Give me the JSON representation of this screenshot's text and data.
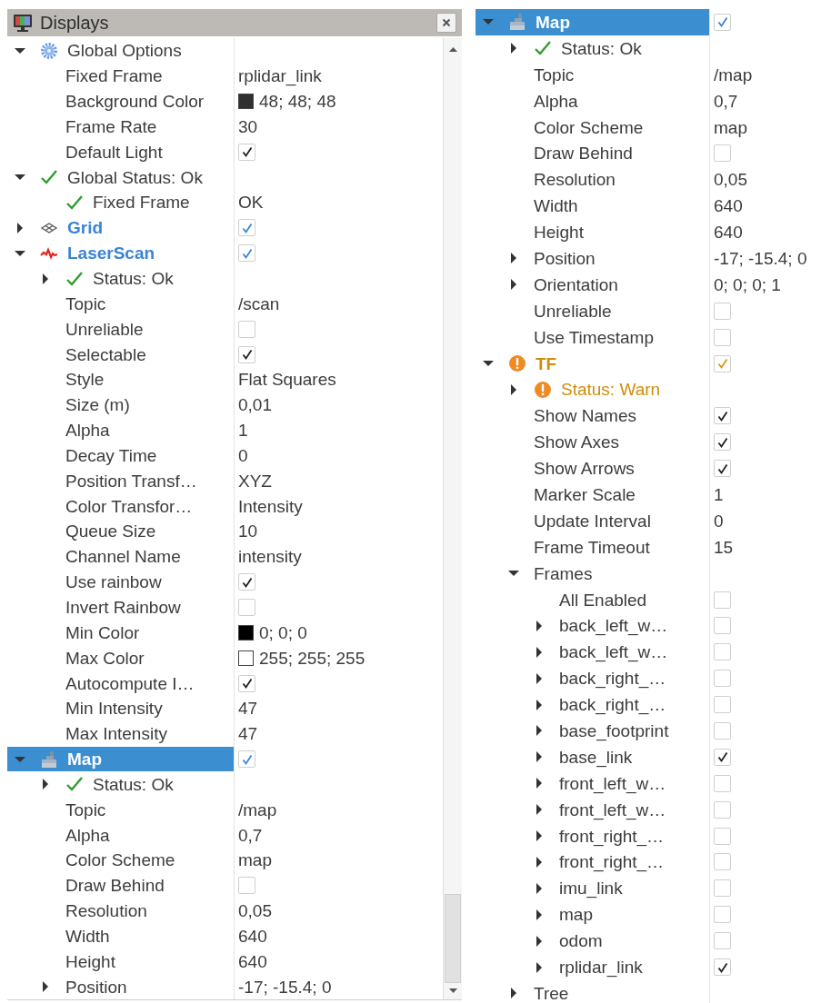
{
  "panels": [
    {
      "title": "Displays",
      "tree": [
        {
          "label": "Global Options",
          "kind": "options",
          "selected": false,
          "expanded": true,
          "children": [
            {
              "label": "Fixed Frame",
              "kind": "property",
              "value": "rplidar_link"
            },
            {
              "label": "Background Color",
              "kind": "color",
              "color": "#303030",
              "value": "48; 48; 48"
            },
            {
              "label": "Frame Rate",
              "kind": "property",
              "value": "30"
            },
            {
              "label": "Default Light",
              "kind": "property",
              "checked": true
            }
          ]
        },
        {
          "label": "Global Status: Ok",
          "kind": "status",
          "warning": false,
          "selected": false,
          "expanded": true,
          "children": [
            {
              "label": "Fixed Frame",
              "kind": "status",
              "warning": false,
              "value": "OK"
            }
          ]
        },
        {
          "label": "Grid",
          "kind": "grid",
          "warning": false,
          "selected": false,
          "expanded": false,
          "checked": true
        },
        {
          "label": "LaserScan",
          "kind": "laserscan",
          "warning": false,
          "selected": false,
          "expanded": true,
          "checked": true,
          "children": [
            {
              "label": "Status: Ok",
              "kind": "status",
              "warning": false,
              "expanded": false
            },
            {
              "label": "Topic",
              "kind": "property",
              "value": "/scan"
            },
            {
              "label": "Unreliable",
              "kind": "property",
              "checked": false
            },
            {
              "label": "Selectable",
              "kind": "property",
              "checked": true
            },
            {
              "label": "Style",
              "kind": "property",
              "value": "Flat Squares"
            },
            {
              "label": "Size (m)",
              "kind": "property",
              "value": "0,01"
            },
            {
              "label": "Alpha",
              "kind": "property",
              "value": "1"
            },
            {
              "label": "Decay Time",
              "kind": "property",
              "value": "0"
            },
            {
              "label": "Position Transf…",
              "kind": "property",
              "value": "XYZ"
            },
            {
              "label": "Color Transfor…",
              "kind": "property",
              "value": "Intensity"
            },
            {
              "label": "Queue Size",
              "kind": "property",
              "value": "10"
            },
            {
              "label": "Channel Name",
              "kind": "property",
              "value": "intensity"
            },
            {
              "label": "Use rainbow",
              "kind": "property",
              "checked": true
            },
            {
              "label": "Invert Rainbow",
              "kind": "property",
              "checked": false
            },
            {
              "label": "Min Color",
              "kind": "color",
              "color": "#000000",
              "value": "0; 0; 0"
            },
            {
              "label": "Max Color",
              "kind": "color",
              "color": "#ffffff",
              "value": "255; 255; 255"
            },
            {
              "label": "Autocompute I…",
              "kind": "property",
              "checked": true
            },
            {
              "label": "Min Intensity",
              "kind": "property",
              "value": "47"
            },
            {
              "label": "Max Intensity",
              "kind": "property",
              "value": "47"
            }
          ]
        },
        {
          "label": "Map",
          "kind": "map",
          "warning": false,
          "selected": true,
          "expanded": true,
          "checked": true,
          "children": [
            {
              "label": "Status: Ok",
              "kind": "status",
              "warning": false,
              "expanded": false
            },
            {
              "label": "Topic",
              "kind": "property",
              "value": "/map"
            },
            {
              "label": "Alpha",
              "kind": "property",
              "value": "0,7"
            },
            {
              "label": "Color Scheme",
              "kind": "property",
              "value": "map"
            },
            {
              "label": "Draw Behind",
              "kind": "property",
              "checked": false
            },
            {
              "label": "Resolution",
              "kind": "property",
              "value": "0,05"
            },
            {
              "label": "Width",
              "kind": "property",
              "value": "640"
            },
            {
              "label": "Height",
              "kind": "property",
              "value": "640"
            },
            {
              "label": "Position",
              "kind": "property",
              "expanded": false,
              "value": "-17; -15.4; 0"
            }
          ]
        }
      ]
    },
    {
      "tree": [
        {
          "label": "Map",
          "kind": "map",
          "warning": false,
          "selected": true,
          "expanded": true,
          "checked": true,
          "children": [
            {
              "label": "Status: Ok",
              "kind": "status",
              "warning": false,
              "expanded": false
            },
            {
              "label": "Topic",
              "kind": "property",
              "value": "/map"
            },
            {
              "label": "Alpha",
              "kind": "property",
              "value": "0,7"
            },
            {
              "label": "Color Scheme",
              "kind": "property",
              "value": "map"
            },
            {
              "label": "Draw Behind",
              "kind": "property",
              "checked": false
            },
            {
              "label": "Resolution",
              "kind": "property",
              "value": "0,05"
            },
            {
              "label": "Width",
              "kind": "property",
              "value": "640"
            },
            {
              "label": "Height",
              "kind": "property",
              "value": "640"
            },
            {
              "label": "Position",
              "kind": "property",
              "expanded": false,
              "value": "-17; -15.4; 0"
            },
            {
              "label": "Orientation",
              "kind": "property",
              "expanded": false,
              "value": "0; 0; 0; 1"
            },
            {
              "label": "Unreliable",
              "kind": "property",
              "checked": false
            },
            {
              "label": "Use Timestamp",
              "kind": "property",
              "checked": false
            }
          ]
        },
        {
          "label": "TF",
          "kind": "tf",
          "warning": true,
          "selected": false,
          "expanded": true,
          "checked": true,
          "children": [
            {
              "label": "Status: Warn",
              "kind": "status",
              "warning": true,
              "expanded": false
            },
            {
              "label": "Show Names",
              "kind": "property",
              "checked": true
            },
            {
              "label": "Show Axes",
              "kind": "property",
              "checked": true
            },
            {
              "label": "Show Arrows",
              "kind": "property",
              "checked": true
            },
            {
              "label": "Marker Scale",
              "kind": "property",
              "value": "1"
            },
            {
              "label": "Update Interval",
              "kind": "property",
              "value": "0"
            },
            {
              "label": "Frame Timeout",
              "kind": "property",
              "value": "15"
            },
            {
              "label": "Frames",
              "kind": "property",
              "expanded": true,
              "children": [
                {
                  "label": "All Enabled",
                  "kind": "property",
                  "checked": false
                },
                {
                  "label": "back_left_w…",
                  "kind": "property",
                  "expanded": false,
                  "checked": false
                },
                {
                  "label": "back_left_w…",
                  "kind": "property",
                  "expanded": false,
                  "checked": false
                },
                {
                  "label": "back_right_…",
                  "kind": "property",
                  "expanded": false,
                  "checked": false
                },
                {
                  "label": "back_right_…",
                  "kind": "property",
                  "expanded": false,
                  "checked": false
                },
                {
                  "label": "base_footprint",
                  "kind": "property",
                  "expanded": false,
                  "checked": false
                },
                {
                  "label": "base_link",
                  "kind": "property",
                  "expanded": false,
                  "checked": true
                },
                {
                  "label": "front_left_w…",
                  "kind": "property",
                  "expanded": false,
                  "checked": false
                },
                {
                  "label": "front_left_w…",
                  "kind": "property",
                  "expanded": false,
                  "checked": false
                },
                {
                  "label": "front_right_…",
                  "kind": "property",
                  "expanded": false,
                  "checked": false
                },
                {
                  "label": "front_right_…",
                  "kind": "property",
                  "expanded": false,
                  "checked": false
                },
                {
                  "label": "imu_link",
                  "kind": "property",
                  "expanded": false,
                  "checked": false
                },
                {
                  "label": "map",
                  "kind": "property",
                  "expanded": false,
                  "checked": false
                },
                {
                  "label": "odom",
                  "kind": "property",
                  "expanded": false,
                  "checked": false
                },
                {
                  "label": "rplidar_link",
                  "kind": "property",
                  "expanded": false,
                  "checked": true
                }
              ]
            },
            {
              "label": "Tree",
              "kind": "property",
              "expanded": false
            }
          ]
        }
      ]
    }
  ]
}
